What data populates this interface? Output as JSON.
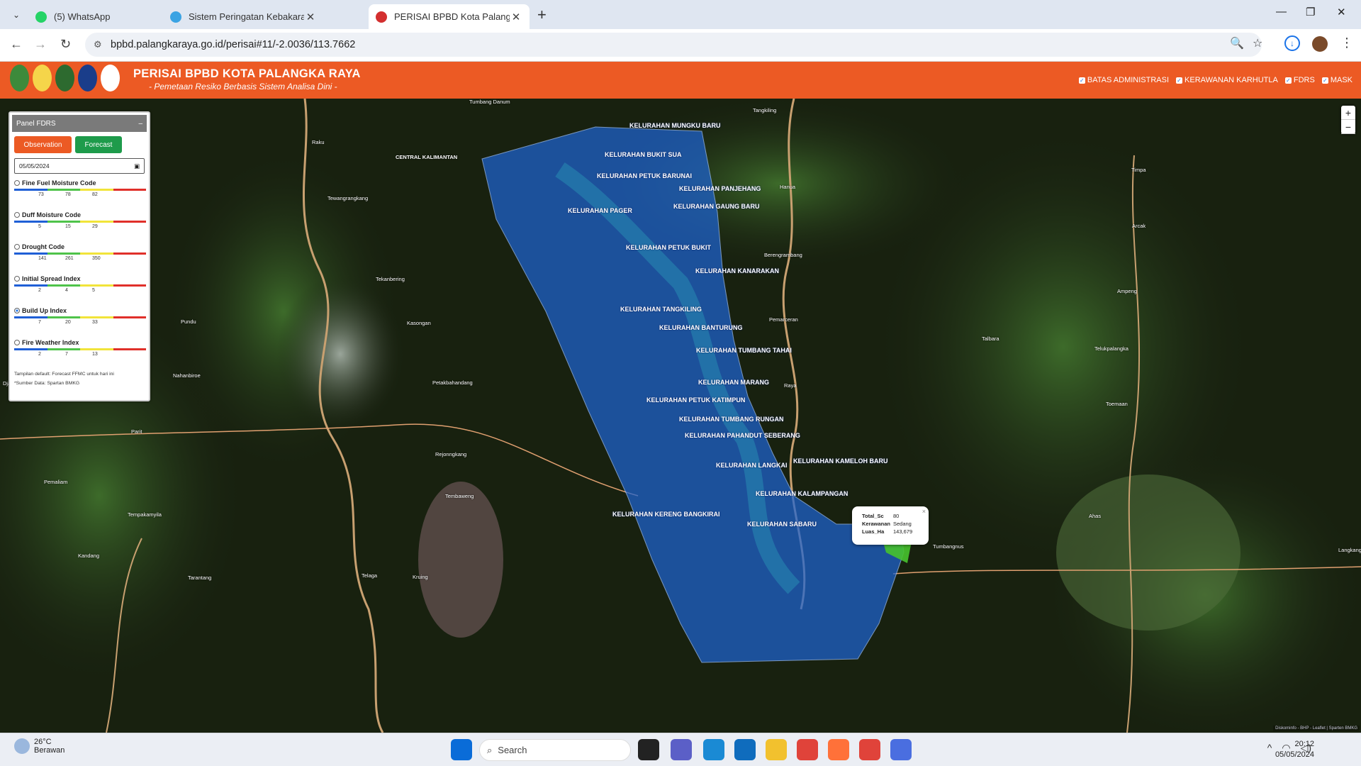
{
  "browser": {
    "tabs": [
      {
        "title": "(5) WhatsApp",
        "color": "#25d366"
      },
      {
        "title": "Sistem Peringatan Kebakaran H",
        "color": "#3aa3e3"
      },
      {
        "title": "PERISAI BPBD Kota Palangka Ra",
        "color": "#d32f2f"
      }
    ],
    "url": "bpbd.palangkaraya.go.id/perisai#11/-2.0036/113.7662"
  },
  "app": {
    "title": "PERISAI BPBD KOTA PALANGKA RAYA",
    "subtitle": "- Pemetaan Resiko Berbasis Sistem Analisa Dini -",
    "layers": [
      "BATAS ADMINISTRASI",
      "KERAWANAN KARHUTLA",
      "FDRS",
      "MASK"
    ]
  },
  "panel": {
    "title": "Panel FDRS",
    "collapse": "–",
    "observation_label": "Observation",
    "forecast_label": "Forecast",
    "date": "05/05/2024",
    "indices": [
      {
        "name": "Fine Fuel Moisture Code",
        "ticks": [
          "73",
          "78",
          "82"
        ],
        "selected": false
      },
      {
        "name": "Duff Moisture Code",
        "ticks": [
          "5",
          "15",
          "29"
        ],
        "selected": false
      },
      {
        "name": "Drought Code",
        "ticks": [
          "141",
          "261",
          "350"
        ],
        "selected": false
      },
      {
        "name": "Initial Spread Index",
        "ticks": [
          "2",
          "4",
          "5"
        ],
        "selected": false
      },
      {
        "name": "Build Up Index",
        "ticks": [
          "7",
          "20",
          "33"
        ],
        "selected": true
      },
      {
        "name": "Fire Weather Index",
        "ticks": [
          "2",
          "7",
          "13"
        ],
        "selected": false
      }
    ],
    "scale_colors": [
      "#1f5fd6",
      "#4fc34a",
      "#f1e43a",
      "#e0302a"
    ],
    "note1": "Tampilan default: Forecast FFMC untuk hari ini",
    "note2": "*Sumber Data: Spartan BMKG"
  },
  "map": {
    "kelurahan": [
      "KELURAHAN MUNGKU BARU",
      "KELURAHAN BUKIT SUA",
      "KELURAHAN PETUK BARUNAI",
      "KELURAHAN PANJEHANG",
      "KELURAHAN PAGER",
      "KELURAHAN GAUNG BARU",
      "KELURAHAN PETUK BUKIT",
      "KELURAHAN KANARAKAN",
      "KELURAHAN TANGKILING",
      "KELURAHAN BANTURUNG",
      "KELURAHAN TUMBANG TAHAI",
      "KELURAHAN MARANG",
      "KELURAHAN PETUK KATIMPUN",
      "KELURAHAN TUMBANG RUNGAN",
      "KELURAHAN PAHANDUT SEBERANG",
      "KELURAHAN LANGKAI",
      "KELURAHAN KAMELOH BARU",
      "KELURAHAN KALAMPANGAN",
      "KELURAHAN KERENG BANGKIRAI",
      "KELURAHAN SABARU"
    ],
    "places": [
      "Tumbang Danum",
      "Tangkiling",
      "Raku",
      "CENTRAL KALIMANTAN",
      "Tewangrangkang",
      "Timpa",
      "Hanua",
      "Arcak",
      "Berengrambang",
      "Tekanbering",
      "Kasongan",
      "Pemarceran",
      "Ampeng",
      "Pundu",
      "Talbara",
      "Telukpalangka",
      "Nahanbiroe",
      "Petakbahandang",
      "Toemaan",
      "Raya",
      "Parit",
      "Pemaliam",
      "Rejonngkang",
      "Tembaweng",
      "Tempakamyila",
      "Kandang",
      "Kruing",
      "Tarantang",
      "Telaga",
      "Tumbangnus",
      "Ahas",
      "Langkang",
      "Djaray"
    ],
    "attribution": "Diskominfo - BHP - Leaflet | Sparten BMKG",
    "zoom_in": "+",
    "zoom_out": "−"
  },
  "popup": {
    "rows": [
      {
        "k": "Total_Sc",
        "v": "80"
      },
      {
        "k": "Kerawanan",
        "v": "Sedang"
      },
      {
        "k": "Luas_Ha",
        "v": "143,679"
      }
    ],
    "close": "×"
  },
  "taskbar": {
    "temp": "26°C",
    "weather": "Berawan",
    "search_placeholder": "Search",
    "time": "20:12",
    "date": "05/05/2024"
  }
}
